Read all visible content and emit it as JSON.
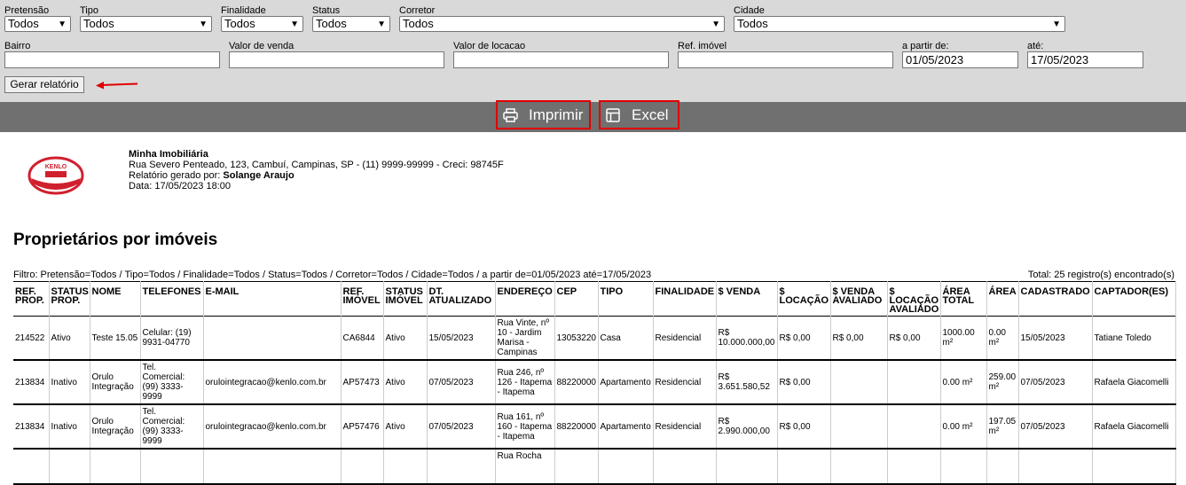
{
  "filters": {
    "pretensao": {
      "label": "Pretensão",
      "value": "Todos"
    },
    "tipo": {
      "label": "Tipo",
      "value": "Todos"
    },
    "finalidade": {
      "label": "Finalidade",
      "value": "Todos"
    },
    "status": {
      "label": "Status",
      "value": "Todos"
    },
    "corretor": {
      "label": "Corretor",
      "value": "Todos"
    },
    "cidade": {
      "label": "Cidade",
      "value": "Todos"
    },
    "bairro": {
      "label": "Bairro",
      "value": ""
    },
    "valor_venda": {
      "label": "Valor de venda",
      "value": ""
    },
    "valor_locacao": {
      "label": "Valor de locacao",
      "value": ""
    },
    "ref_imovel": {
      "label": "Ref. imóvel",
      "value": ""
    },
    "a_partir_de": {
      "label": "a partir de:",
      "value": "01/05/2023"
    },
    "ate": {
      "label": "até:",
      "value": "17/05/2023"
    },
    "gerar_label": "Gerar relatório"
  },
  "actions": {
    "imprimir": "Imprimir",
    "excel": "Excel"
  },
  "colors": {
    "highlight": "#e00000",
    "bar": "#707070",
    "filter_bg": "#d9d9d9",
    "logo_red": "#d0202e"
  },
  "company": {
    "logo_text": "KENLO",
    "name": "Minha Imobiliária",
    "address": "Rua Severo Penteado, 123, Cambuí, Campinas, SP - (11) 9999-99999 - Creci: 98745F",
    "generated_by_label": "Relatório gerado por:",
    "generated_by": "Solange Araujo",
    "date": "Data: 17/05/2023 18:00"
  },
  "report": {
    "title": "Proprietários por imóveis",
    "filter_text": "Filtro: Pretensão=Todos / Tipo=Todos / Finalidade=Todos / Status=Todos / Corretor=Todos / Cidade=Todos / a partir de=01/05/2023 até=17/05/2023",
    "total_text": "Total: 25 registro(s) encontrado(s)",
    "columns": [
      "REF. PROP.",
      "STATUS PROP.",
      "NOME",
      "TELEFONES",
      "E-MAIL",
      "REF. IMÓVEL",
      "STATUS IMÓVEL",
      "DT. ATUALIZADO",
      "ENDEREÇO",
      "CEP",
      "TIPO",
      "FINALIDADE",
      "$ VENDA",
      "$ LOCAÇÃO",
      "$ VENDA AVALIADO",
      "$ LOCAÇÃO AVALIADO",
      "ÁREA TOTAL",
      "ÁREA",
      "CADASTRADO",
      "CAPTADOR(ES)"
    ],
    "rows": [
      [
        "214522",
        "Ativo",
        "Teste 15.05",
        "Celular: (19) 9931-04770",
        "",
        "CA6844",
        "Ativo",
        "15/05/2023",
        "Rua Vinte, nº 10 - Jardim Marisa - Campinas",
        "13053220",
        "Casa",
        "Residencial",
        "R$ 10.000.000,00",
        "R$ 0,00",
        "R$ 0,00",
        "R$ 0,00",
        "1000.00 m²",
        "0.00 m²",
        "15/05/2023",
        "Tatiane Toledo"
      ],
      [
        "213834",
        "Inativo",
        "Orulo Integração",
        "Tel. Comercial: (99) 3333-9999",
        "orulointegracao@kenlo.com.br",
        "AP57473",
        "Ativo",
        "07/05/2023",
        "Rua 246, nº 126 - Itapema - Itapema",
        "88220000",
        "Apartamento",
        "Residencial",
        "R$ 3.651.580,52",
        "R$ 0,00",
        "",
        "",
        "0.00 m²",
        "259.00 m²",
        "07/05/2023",
        "Rafaela Giacomelli"
      ],
      [
        "213834",
        "Inativo",
        "Orulo Integração",
        "Tel. Comercial: (99) 3333-9999",
        "orulointegracao@kenlo.com.br",
        "AP57476",
        "Ativo",
        "07/05/2023",
        "Rua 161, nº 160 - Itapema - Itapema",
        "88220000",
        "Apartamento",
        "Residencial",
        "R$ 2.990.000,00",
        "R$ 0,00",
        "",
        "",
        "0.00 m²",
        "197.05 m²",
        "07/05/2023",
        "Rafaela Giacomelli"
      ],
      [
        "",
        "",
        "",
        "",
        "",
        "",
        "",
        "",
        "Rua Rocha",
        "",
        "",
        "",
        "",
        "",
        "",
        "",
        "",
        "",
        "",
        ""
      ]
    ]
  }
}
